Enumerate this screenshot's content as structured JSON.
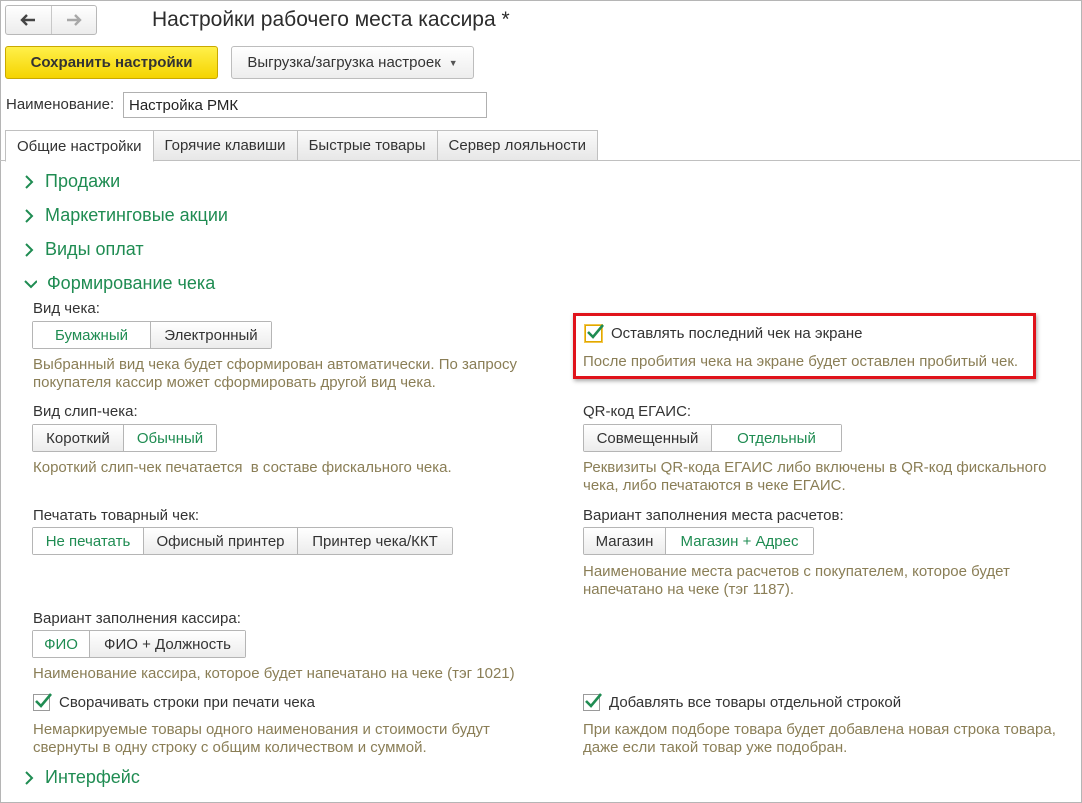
{
  "window": {
    "title": "Настройки рабочего места кассира *",
    "nav_back_icon": "arrow-left-icon",
    "nav_forward_icon": "arrow-right-icon"
  },
  "toolbar": {
    "save_label": "Сохранить настройки",
    "export_label": "Выгрузка/загрузка настроек",
    "accent_color": "#f5d400"
  },
  "name_field": {
    "label": "Наименование:",
    "value": "Настройка РМК"
  },
  "tabs": [
    {
      "label": "Общие настройки",
      "active": true
    },
    {
      "label": "Горячие клавиши",
      "active": false
    },
    {
      "label": "Быстрые товары",
      "active": false
    },
    {
      "label": "Сервер лояльности",
      "active": false
    }
  ],
  "sections": {
    "sales": "Продажи",
    "marketing": "Маркетинговые акции",
    "payments": "Виды оплат",
    "receipt": "Формирование чека",
    "interface": "Интерфейс"
  },
  "receipt": {
    "receipt_type": {
      "label": "Вид чека:",
      "options": [
        "Бумажный",
        "Электронный"
      ],
      "selected": "Бумажный",
      "hint": "Выбранный вид чека будет сформирован автоматически. По запросу покупателя кассир может сформировать другой вид чека."
    },
    "keep_last": {
      "label": "Оставлять последний чек на экране",
      "checked": true,
      "hint": "После пробития чека на экране будет оставлен пробитый чек."
    },
    "slip_type": {
      "label": "Вид слип-чека:",
      "options": [
        "Короткий",
        "Обычный"
      ],
      "selected": "Обычный",
      "hint": "Короткий слип-чек печатается  в составе фискального чека."
    },
    "qr_egais": {
      "label": "QR-код ЕГАИС:",
      "options": [
        "Совмещенный",
        "Отдельный"
      ],
      "selected": "Отдельный",
      "hint": "Реквизиты QR-кода ЕГАИС либо включены в QR-код фискального чека, либо печатаются в чеке ЕГАИС."
    },
    "goods_receipt": {
      "label": "Печатать товарный чек:",
      "options": [
        "Не печатать",
        "Офисный принтер",
        "Принтер чека/ККТ"
      ],
      "selected": "Не печатать"
    },
    "payment_place": {
      "label": "Вариант заполнения места расчетов:",
      "options": [
        "Магазин",
        "Магазин + Адрес"
      ],
      "selected": "Магазин + Адрес",
      "hint": "Наименование места расчетов с покупателем, которое будет напечатано на чеке (тэг 1187)."
    },
    "cashier_fill": {
      "label": "Вариант заполнения кассира:",
      "options": [
        "ФИО",
        "ФИО + Должность"
      ],
      "selected": "ФИО",
      "hint": "Наименование кассира, которое будет напечатано на чеке (тэг 1021)"
    },
    "collapse_rows": {
      "label": "Сворачивать строки при печати чека",
      "checked": true,
      "hint": "Немаркируемые товары одного наименования и стоимости будут свернуты в одну строку с общим количеством и суммой."
    },
    "separate_rows": {
      "label": "Добавлять все товары отдельной строкой",
      "checked": true,
      "hint": "При каждом подборе товара будет добавлена новая строка товара, даже если такой товар уже подобран."
    }
  },
  "colors": {
    "section": "#1f8c52",
    "hint": "#8a7e56",
    "highlight": "#e0131b"
  }
}
